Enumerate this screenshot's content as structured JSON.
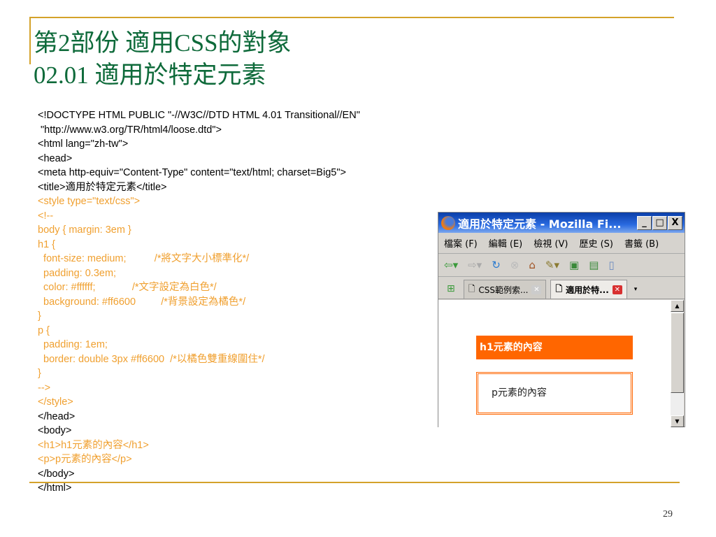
{
  "slide": {
    "title_line1": "第2部份 適用CSS的對象",
    "title_line2": "02.01 適用於特定元素",
    "page_number": "29"
  },
  "code": {
    "lines": [
      {
        "text": "<!DOCTYPE HTML PUBLIC \"-//W3C//DTD HTML 4.01 Transitional//EN\"",
        "hl": false
      },
      {
        "text": " \"http://www.w3.org/TR/html4/loose.dtd\">",
        "hl": false
      },
      {
        "text": "<html lang=\"zh-tw\">",
        "hl": false
      },
      {
        "text": "<head>",
        "hl": false
      },
      {
        "text": "<meta http-equiv=\"Content-Type\" content=\"text/html; charset=Big5\">",
        "hl": false
      },
      {
        "text": "<title>適用於特定元素</title>",
        "hl": false
      },
      {
        "text": "<style type=\"text/css\">",
        "hl": true
      },
      {
        "text": "<!--",
        "hl": true
      },
      {
        "text": "body { margin: 3em }",
        "hl": true
      },
      {
        "text": "h1 {",
        "hl": true
      },
      {
        "text": "  font-size: medium;          /*將文字大小標準化*/",
        "hl": true
      },
      {
        "text": "  padding: 0.3em;",
        "hl": true
      },
      {
        "text": "  color: #ffffff;             /*文字設定為白色*/",
        "hl": true
      },
      {
        "text": "  background: #ff6600         /*背景設定為橘色*/",
        "hl": true
      },
      {
        "text": "}",
        "hl": true
      },
      {
        "text": "p {",
        "hl": true
      },
      {
        "text": "  padding: 1em;",
        "hl": true
      },
      {
        "text": "  border: double 3px #ff6600  /*以橘色雙重線圍住*/",
        "hl": true
      },
      {
        "text": "}",
        "hl": true
      },
      {
        "text": "-->",
        "hl": true
      },
      {
        "text": "</style>",
        "hl": true
      },
      {
        "text": "</head>",
        "hl": false
      },
      {
        "text": "<body>",
        "hl": false
      },
      {
        "text": "<h1>h1元素的內容</h1>",
        "hl": true
      },
      {
        "text": "<p>p元素的內容</p>",
        "hl": true
      },
      {
        "text": "</body>",
        "hl": false
      },
      {
        "text": "</html>",
        "hl": false
      }
    ]
  },
  "browser": {
    "title": "適用於特定元素 - Mozilla Fi...",
    "window_buttons": [
      "_",
      "□",
      "X"
    ],
    "menu": [
      "檔案 (F)",
      "編輯 (E)",
      "檢視 (V)",
      "歷史 (S)",
      "書籤 (B)"
    ],
    "toolbar_icons": [
      "back-icon",
      "forward-icon",
      "reload-icon",
      "stop-icon",
      "home-icon",
      "bookmark-icon",
      "new-window-icon",
      "new-tab-icon",
      "sidebar-icon"
    ],
    "tabs": [
      {
        "label": "CSS範例索...",
        "active": false
      },
      {
        "label": "適用於特...",
        "active": true
      }
    ],
    "content": {
      "h1": "h1元素的內容",
      "p": "p元素的內容"
    }
  }
}
